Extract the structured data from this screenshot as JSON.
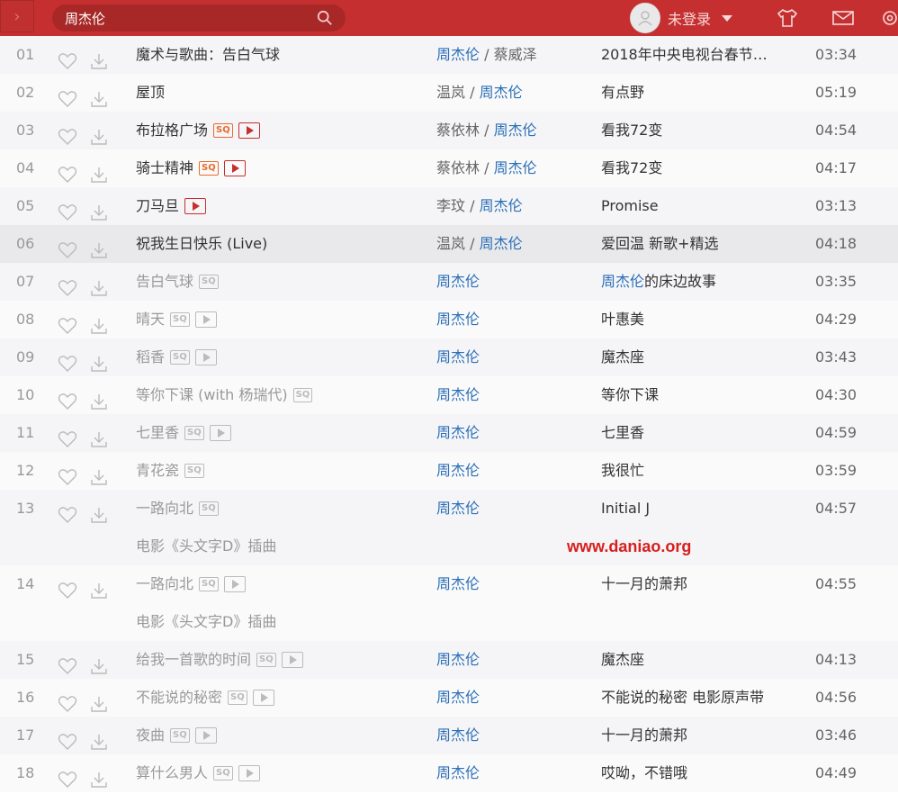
{
  "header": {
    "search_query": "周杰伦",
    "user_label": "未登录"
  },
  "rows": [
    {
      "idx": "01",
      "title": "魔术与歌曲：告白气球",
      "artists": [
        {
          "t": "周杰伦",
          "link": true
        },
        {
          "t": " / ",
          "link": false
        },
        {
          "t": "蔡威泽",
          "link": false
        }
      ],
      "album": [
        {
          "t": "2018年中央电视台春节…",
          "link": false
        }
      ],
      "dur": "03:34",
      "dim": false,
      "sq": false,
      "mv": false
    },
    {
      "idx": "02",
      "title": "屋顶",
      "artists": [
        {
          "t": "温岚",
          "link": false
        },
        {
          "t": " / ",
          "link": false
        },
        {
          "t": "周杰伦",
          "link": true
        }
      ],
      "album": [
        {
          "t": "有点野",
          "link": false
        }
      ],
      "dur": "05:19",
      "dim": false,
      "sq": false,
      "mv": false
    },
    {
      "idx": "03",
      "title": "布拉格广场",
      "artists": [
        {
          "t": "蔡依林",
          "link": false
        },
        {
          "t": " / ",
          "link": false
        },
        {
          "t": "周杰伦",
          "link": true
        }
      ],
      "album": [
        {
          "t": "看我72变",
          "link": false
        }
      ],
      "dur": "04:54",
      "dim": false,
      "sq": true,
      "mv": true
    },
    {
      "idx": "04",
      "title": "骑士精神",
      "artists": [
        {
          "t": "蔡依林",
          "link": false
        },
        {
          "t": " / ",
          "link": false
        },
        {
          "t": "周杰伦",
          "link": true
        }
      ],
      "album": [
        {
          "t": "看我72变",
          "link": false
        }
      ],
      "dur": "04:17",
      "dim": false,
      "sq": true,
      "mv": true
    },
    {
      "idx": "05",
      "title": "刀马旦",
      "artists": [
        {
          "t": "李玟",
          "link": false
        },
        {
          "t": " / ",
          "link": false
        },
        {
          "t": "周杰伦",
          "link": true
        }
      ],
      "album": [
        {
          "t": "Promise",
          "link": false
        }
      ],
      "dur": "03:13",
      "dim": false,
      "sq": false,
      "mv": true
    },
    {
      "idx": "06",
      "title": "祝我生日快乐 (Live)",
      "artists": [
        {
          "t": "温岚",
          "link": false
        },
        {
          "t": " / ",
          "link": false
        },
        {
          "t": "周杰伦",
          "link": true
        }
      ],
      "album": [
        {
          "t": "爱回温 新歌+精选",
          "link": false
        }
      ],
      "dur": "04:18",
      "dim": false,
      "sq": false,
      "mv": false,
      "hl": true
    },
    {
      "idx": "07",
      "title": "告白气球",
      "artists": [
        {
          "t": "周杰伦",
          "link": true
        }
      ],
      "album": [
        {
          "t": "周杰伦",
          "link": true
        },
        {
          "t": "的床边故事",
          "link": false
        }
      ],
      "dur": "03:35",
      "dim": true,
      "sq": true,
      "mv": false
    },
    {
      "idx": "08",
      "title": "晴天",
      "artists": [
        {
          "t": "周杰伦",
          "link": true
        }
      ],
      "album": [
        {
          "t": "叶惠美",
          "link": false
        }
      ],
      "dur": "04:29",
      "dim": true,
      "sq": true,
      "mv": true
    },
    {
      "idx": "09",
      "title": "稻香",
      "artists": [
        {
          "t": "周杰伦",
          "link": true
        }
      ],
      "album": [
        {
          "t": "魔杰座",
          "link": false
        }
      ],
      "dur": "03:43",
      "dim": true,
      "sq": true,
      "mv": true
    },
    {
      "idx": "10",
      "title": "等你下课 (with 杨瑞代)",
      "artists": [
        {
          "t": "周杰伦",
          "link": true
        }
      ],
      "album": [
        {
          "t": "等你下课",
          "link": false
        }
      ],
      "dur": "04:30",
      "dim": true,
      "sq": true,
      "mv": false
    },
    {
      "idx": "11",
      "title": "七里香",
      "artists": [
        {
          "t": "周杰伦",
          "link": true
        }
      ],
      "album": [
        {
          "t": "七里香",
          "link": false
        }
      ],
      "dur": "04:59",
      "dim": true,
      "sq": true,
      "mv": true
    },
    {
      "idx": "12",
      "title": "青花瓷",
      "artists": [
        {
          "t": "周杰伦",
          "link": true
        }
      ],
      "album": [
        {
          "t": "我很忙",
          "link": false
        }
      ],
      "dur": "03:59",
      "dim": true,
      "sq": true,
      "mv": false
    },
    {
      "idx": "13",
      "title": "一路向北",
      "artists": [
        {
          "t": "周杰伦",
          "link": true
        }
      ],
      "album": [
        {
          "t": "Initial J",
          "link": false
        }
      ],
      "dur": "04:57",
      "dim": true,
      "sq": true,
      "mv": false,
      "subtitle": "电影《头文字D》插曲",
      "watermark": "www.daniao.org"
    },
    {
      "idx": "14",
      "title": "一路向北",
      "artists": [
        {
          "t": "周杰伦",
          "link": true
        }
      ],
      "album": [
        {
          "t": "十一月的萧邦",
          "link": false
        }
      ],
      "dur": "04:55",
      "dim": true,
      "sq": true,
      "mv": true,
      "subtitle": "电影《头文字D》插曲"
    },
    {
      "idx": "15",
      "title": "给我一首歌的时间",
      "artists": [
        {
          "t": "周杰伦",
          "link": true
        }
      ],
      "album": [
        {
          "t": "魔杰座",
          "link": false
        }
      ],
      "dur": "04:13",
      "dim": true,
      "sq": true,
      "mv": true
    },
    {
      "idx": "16",
      "title": "不能说的秘密",
      "artists": [
        {
          "t": "周杰伦",
          "link": true
        }
      ],
      "album": [
        {
          "t": "不能说的秘密 电影原声带",
          "link": false
        }
      ],
      "dur": "04:56",
      "dim": true,
      "sq": true,
      "mv": true
    },
    {
      "idx": "17",
      "title": "夜曲",
      "artists": [
        {
          "t": "周杰伦",
          "link": true
        }
      ],
      "album": [
        {
          "t": "十一月的萧邦",
          "link": false
        }
      ],
      "dur": "03:46",
      "dim": true,
      "sq": true,
      "mv": true
    },
    {
      "idx": "18",
      "title": "算什么男人",
      "artists": [
        {
          "t": "周杰伦",
          "link": true
        }
      ],
      "album": [
        {
          "t": "哎呦，不错哦",
          "link": false
        }
      ],
      "dur": "04:49",
      "dim": true,
      "sq": true,
      "mv": true
    }
  ],
  "badges": {
    "sq": "SQ"
  }
}
